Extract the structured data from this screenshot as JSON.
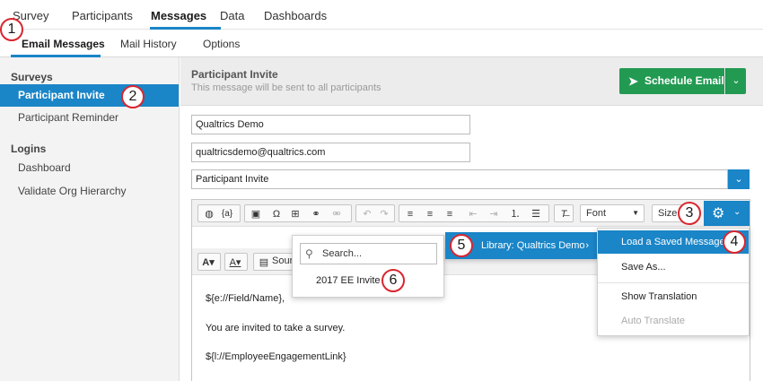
{
  "top_nav": {
    "tabs": [
      "Survey",
      "Participants",
      "Messages",
      "Data",
      "Dashboards"
    ],
    "active": "Messages"
  },
  "sub_nav": {
    "tabs": [
      "Email Messages",
      "Mail History",
      "Options"
    ],
    "active": "Email Messages"
  },
  "sidebar": {
    "surveys_heading": "Surveys",
    "survey_items": [
      "Participant Invite",
      "Participant Reminder"
    ],
    "logins_heading": "Logins",
    "login_items": [
      "Dashboard",
      "Validate Org Hierarchy"
    ]
  },
  "header": {
    "title": "Participant Invite",
    "subtitle": "This message will be sent to all participants",
    "schedule_button": "Schedule Email",
    "schedule_icon": "paper-plane-icon",
    "dropdown_caret": "⌄"
  },
  "fields": {
    "from_name": "Qualtrics Demo",
    "from_email": "qualtricsdemo@qualtrics.com",
    "subject": "Participant Invite"
  },
  "toolbar": {
    "font_label": "Font",
    "size_label": "Size",
    "source_label": "Source",
    "insert_piped_text": "{a}"
  },
  "message_body": {
    "line1": "${e://Field/Name},",
    "line2": "You are invited to take a survey.",
    "line3": "${l://EmployeeEngagementLink}"
  },
  "gear_menu": {
    "items": [
      "Load a Saved Message",
      "Save As...",
      "Show Translation",
      "Auto Translate"
    ],
    "highlighted": "Load a Saved Message",
    "disabled": "Auto Translate"
  },
  "library_menu": {
    "label": "Library: Qualtrics Demo"
  },
  "saved_messages_menu": {
    "search_placeholder": "Search...",
    "items": [
      "2017 EE Invite"
    ]
  },
  "callouts": [
    "1",
    "2",
    "3",
    "4",
    "5",
    "6"
  ],
  "colors": {
    "accent_blue": "#1a85c7",
    "schedule_green": "#239a52",
    "callout_red": "#d9262f"
  }
}
